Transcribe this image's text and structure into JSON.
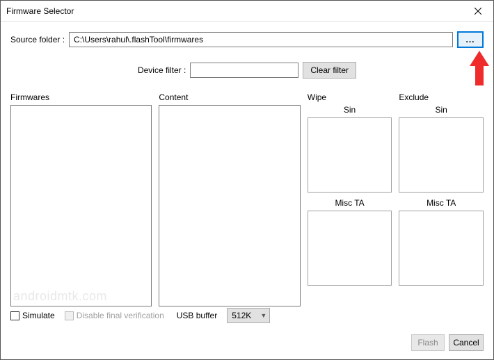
{
  "window": {
    "title": "Firmware Selector"
  },
  "source": {
    "label": "Source folder :",
    "value": "C:\\Users\\rahul\\.flashTool\\firmwares",
    "browse_label": "..."
  },
  "filter": {
    "label": "Device filter :",
    "value": "",
    "clear_label": "Clear filter"
  },
  "columns": {
    "firmwares": "Firmwares",
    "content": "Content",
    "wipe": "Wipe",
    "exclude": "Exclude",
    "sin": "Sin",
    "misc_ta": "Misc TA"
  },
  "bottom": {
    "simulate": "Simulate",
    "disable_verification": "Disable final verification",
    "usb_buffer_label": "USB buffer",
    "usb_buffer_value": "512K"
  },
  "actions": {
    "flash": "Flash",
    "cancel": "Cancel"
  },
  "watermark": "androidmtk.com"
}
